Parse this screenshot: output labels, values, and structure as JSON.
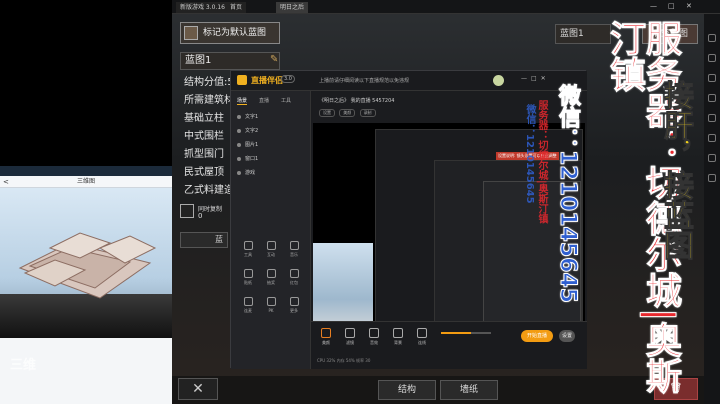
{
  "phone": {
    "title": "三维图",
    "back": "<",
    "logo": "三维"
  },
  "game": {
    "tabs": [
      "新版游戏 3.0.16",
      "首页",
      "明日之后"
    ],
    "window_controls": [
      "—",
      "□",
      "✕"
    ],
    "mark_button": "标记为默认蓝图",
    "blueprint_name": "蓝图1",
    "blueprint_right": "蓝图1",
    "clear_button": "清空蓝图",
    "menu": [
      "结构分值:54",
      "所需建筑材料",
      "基础立柱",
      "中式围栏",
      "抓型围门",
      "民式屋顶",
      "乙式料建造"
    ],
    "build_confirm": "同时复制",
    "build_count": "0",
    "blue_label": "蓝",
    "bottom_buttons": [
      "结构",
      "墙纸"
    ],
    "clear_x": "✕",
    "trash": "🗑"
  },
  "app": {
    "name": "直播伴侣",
    "version": "3.0",
    "notice": "上播前请仔细阅读以下直播规范以免违规",
    "room_info": "《明日之后》 我的直播 5457204",
    "chips": [
      "设置",
      "美颜",
      "录制"
    ],
    "side_tabs": [
      "场景",
      "直播",
      "工具"
    ],
    "layers": [
      "文字1",
      "文字2",
      "图片1",
      "窗口1",
      "游戏"
    ],
    "tools": [
      "工具",
      "互动",
      "音乐",
      "贴纸",
      "抽奖",
      "红包",
      "连麦",
      "PK",
      "更多"
    ],
    "red_note": "设置说明: 镜头设置可以在此调整",
    "bottom_tools": [
      "美颜",
      "滤镜",
      "音效",
      "背景",
      "连线"
    ],
    "live_button": "开始直播",
    "settings_button": "设置",
    "bottom_info": "CPU 32%  内存 54%  帧率 30"
  },
  "overlay": {
    "server": "服务器：切德尔城|奥斯汀镇",
    "wechat": "微信：1210145645",
    "work": "接肝，接蓝图",
    "mirror_blue": "微信：1210145645",
    "mirror_red": "服务器：切德尔城|奥斯汀镇"
  }
}
